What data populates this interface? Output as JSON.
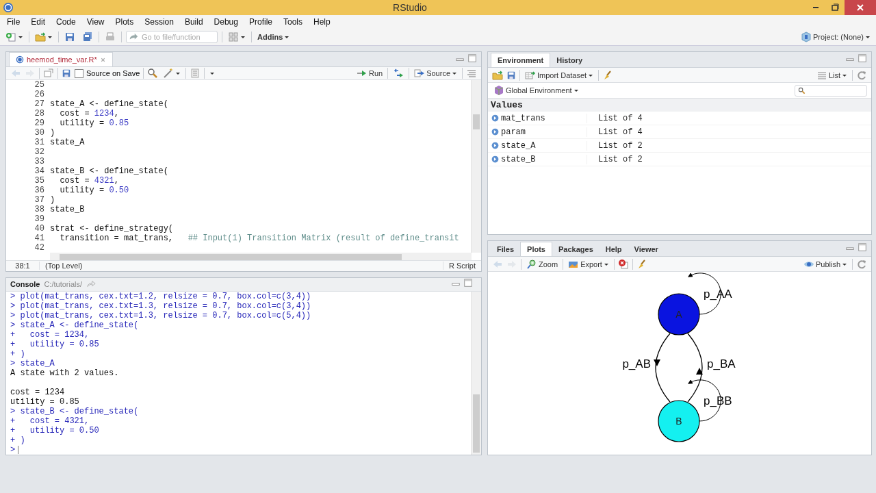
{
  "window": {
    "title": "RStudio"
  },
  "menu": [
    "File",
    "Edit",
    "Code",
    "View",
    "Plots",
    "Session",
    "Build",
    "Debug",
    "Profile",
    "Tools",
    "Help"
  ],
  "toolbar": {
    "goto_placeholder": "Go to file/function",
    "addins": "Addins",
    "project": "Project: (None)"
  },
  "editor": {
    "tabs": [
      {
        "label": "heemod_time_var.R*",
        "selected": true
      }
    ],
    "source_on_save": {
      "label": "Source on Save",
      "checked": false
    },
    "run": "Run",
    "source": "Source",
    "lines": [
      {
        "number": "25"
      },
      {
        "number": "26"
      },
      {
        "number": "27",
        "tokens": [
          {
            "kind": "plain",
            "text": "state_A <- define_state("
          }
        ]
      },
      {
        "number": "28",
        "tokens": [
          {
            "kind": "plain",
            "text": "  cost = "
          },
          {
            "kind": "number",
            "text": "1234"
          },
          {
            "kind": "plain",
            "text": ","
          }
        ]
      },
      {
        "number": "29",
        "tokens": [
          {
            "kind": "plain",
            "text": "  utility = "
          },
          {
            "kind": "number",
            "text": "0.85"
          }
        ]
      },
      {
        "number": "30",
        "tokens": [
          {
            "kind": "plain",
            "text": ")"
          }
        ]
      },
      {
        "number": "31",
        "tokens": [
          {
            "kind": "plain",
            "text": "state_A"
          }
        ]
      },
      {
        "number": "32"
      },
      {
        "number": "33"
      },
      {
        "number": "34",
        "tokens": [
          {
            "kind": "plain",
            "text": "state_B <- define_state("
          }
        ]
      },
      {
        "number": "35",
        "tokens": [
          {
            "kind": "plain",
            "text": "  cost = "
          },
          {
            "kind": "number",
            "text": "4321"
          },
          {
            "kind": "plain",
            "text": ","
          }
        ]
      },
      {
        "number": "36",
        "tokens": [
          {
            "kind": "plain",
            "text": "  utility = "
          },
          {
            "kind": "number",
            "text": "0.50"
          }
        ]
      },
      {
        "number": "37",
        "tokens": [
          {
            "kind": "plain",
            "text": ")"
          }
        ]
      },
      {
        "number": "38",
        "tokens": [
          {
            "kind": "plain",
            "text": "state_B"
          }
        ]
      },
      {
        "number": "39"
      },
      {
        "number": "40",
        "tokens": [
          {
            "kind": "plain",
            "text": "strat <- define_strategy("
          }
        ]
      },
      {
        "number": "41",
        "tokens": [
          {
            "kind": "plain",
            "text": "  transition = mat_trans,   "
          },
          {
            "kind": "comment",
            "text": "## Input(1) Transition Matrix (result of define_transit"
          }
        ]
      },
      {
        "number": "42"
      }
    ],
    "status": {
      "position": "38:1",
      "scope": "(Top Level)",
      "filetype": "R Script"
    }
  },
  "console": {
    "title": "Console",
    "path": "C:/tutorials/",
    "lines": [
      {
        "kind": "input",
        "text": "> plot(mat_trans, cex.txt=1.2, relsize = 0.7, box.col=c(3,4))"
      },
      {
        "kind": "input",
        "text": "> plot(mat_trans, cex.txt=1.3, relsize = 0.7, box.col=c(3,4))"
      },
      {
        "kind": "input",
        "text": "> plot(mat_trans, cex.txt=1.3, relsize = 0.7, box.col=c(5,4))"
      },
      {
        "kind": "input",
        "text": "> state_A <- define_state("
      },
      {
        "kind": "input",
        "text": "+   cost = 1234,"
      },
      {
        "kind": "input",
        "text": "+   utility = 0.85"
      },
      {
        "kind": "input",
        "text": "+ )"
      },
      {
        "kind": "input",
        "text": "> state_A"
      },
      {
        "kind": "output",
        "text": "A state with 2 values."
      },
      {
        "kind": "blank"
      },
      {
        "kind": "output",
        "text": "cost = 1234"
      },
      {
        "kind": "output",
        "text": "utility = 0.85"
      },
      {
        "kind": "input",
        "text": "> state_B <- define_state("
      },
      {
        "kind": "input",
        "text": "+   cost = 4321,"
      },
      {
        "kind": "input",
        "text": "+   utility = 0.50"
      },
      {
        "kind": "input",
        "text": "+ )"
      },
      {
        "kind": "prompt",
        "text": ">"
      }
    ]
  },
  "environment": {
    "tabs": [
      {
        "label": "Environment",
        "selected": true
      },
      {
        "label": "History",
        "selected": false
      }
    ],
    "import": "Import Dataset",
    "view": "List",
    "scope": "Global Environment",
    "section": "Values",
    "rows": [
      {
        "name": "mat_trans",
        "value": "List of 4"
      },
      {
        "name": "param",
        "value": "List of 4"
      },
      {
        "name": "state_A",
        "value": "List of 2"
      },
      {
        "name": "state_B",
        "value": "List of 2"
      }
    ]
  },
  "plots_pane": {
    "tabs": [
      {
        "label": "Files",
        "selected": false
      },
      {
        "label": "Plots",
        "selected": true
      },
      {
        "label": "Packages",
        "selected": false
      },
      {
        "label": "Help",
        "selected": false
      },
      {
        "label": "Viewer",
        "selected": false
      }
    ],
    "zoom": "Zoom",
    "export": "Export",
    "publish": "Publish",
    "diagram": {
      "nodes": [
        {
          "label": "A",
          "color": "#0a14e0",
          "loop_label": "p_AA"
        },
        {
          "label": "B",
          "color": "#14f0f0",
          "loop_label": "p_BB"
        }
      ],
      "edges": [
        {
          "label": "p_AB"
        },
        {
          "label": "p_BA"
        }
      ]
    }
  }
}
